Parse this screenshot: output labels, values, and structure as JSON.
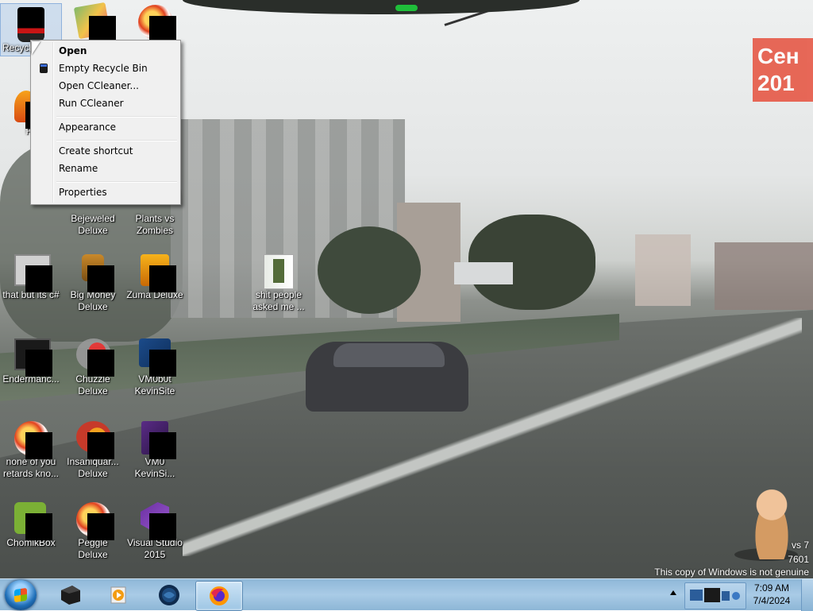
{
  "desktop": {
    "icons": [
      {
        "id": "recycle-bin",
        "label": "Recycle Bin"
      },
      {
        "id": "folder-top-2",
        "label": ""
      },
      {
        "id": "orb-top-3",
        "label": ""
      },
      {
        "id": "firefox-left",
        "label": "Fire"
      },
      {
        "id": "bejeweled",
        "label": "Bejeweled Deluxe"
      },
      {
        "id": "plants-vs-zombies",
        "label": "Plants vs Zombies"
      },
      {
        "id": "that-but-its-csharp",
        "label": "that but its c#"
      },
      {
        "id": "big-money",
        "label": "Big Money Deluxe"
      },
      {
        "id": "zuma",
        "label": "Zuma Deluxe"
      },
      {
        "id": "shit-people",
        "label": "shit people asked me ..."
      },
      {
        "id": "endermanc",
        "label": "Endermanc..."
      },
      {
        "id": "chuzzle",
        "label": "Chuzzle Deluxe"
      },
      {
        "id": "vm0b0t",
        "label": "VM0b0t KevinSite"
      },
      {
        "id": "none-of-you",
        "label": "none of you retards kno..."
      },
      {
        "id": "insaniquarium",
        "label": "Insaniquar... Deluxe"
      },
      {
        "id": "vm0-kevinsi",
        "label": "VM0 KevinSi..."
      },
      {
        "id": "chomikbox",
        "label": "ChomikBox"
      },
      {
        "id": "peggle",
        "label": "Peggle Deluxe"
      },
      {
        "id": "visual-studio",
        "label": "Visual Studio 2015"
      }
    ]
  },
  "context_menu": {
    "items": [
      {
        "label": "Open",
        "bold": true
      },
      {
        "label": "Empty Recycle Bin"
      },
      {
        "label": "Open CCleaner..."
      },
      {
        "label": "Run CCleaner"
      },
      {
        "label": "Appearance"
      },
      {
        "label": "Create shortcut"
      },
      {
        "label": "Rename"
      },
      {
        "label": "Properties"
      }
    ]
  },
  "watermark": {
    "line1": "vs 7",
    "line2": "7601",
    "line3": "This copy of Windows is not genuine"
  },
  "wallpaper": {
    "sign_text": "Сен 201"
  },
  "taskbar": {
    "buttons": [
      {
        "id": "start",
        "name": "start-button"
      },
      {
        "id": "dark-app",
        "name": "taskbar-app-1"
      },
      {
        "id": "media",
        "name": "taskbar-media-player"
      },
      {
        "id": "globe",
        "name": "taskbar-app-3"
      },
      {
        "id": "firefox",
        "name": "taskbar-firefox",
        "active": true
      }
    ],
    "clock": {
      "time": "7:09 AM",
      "date": "7/4/2024"
    }
  },
  "colors": {
    "taskbar": "#a9cbe6",
    "menu_bg": "#f0f0f0",
    "selection": "#8fb2dc"
  }
}
